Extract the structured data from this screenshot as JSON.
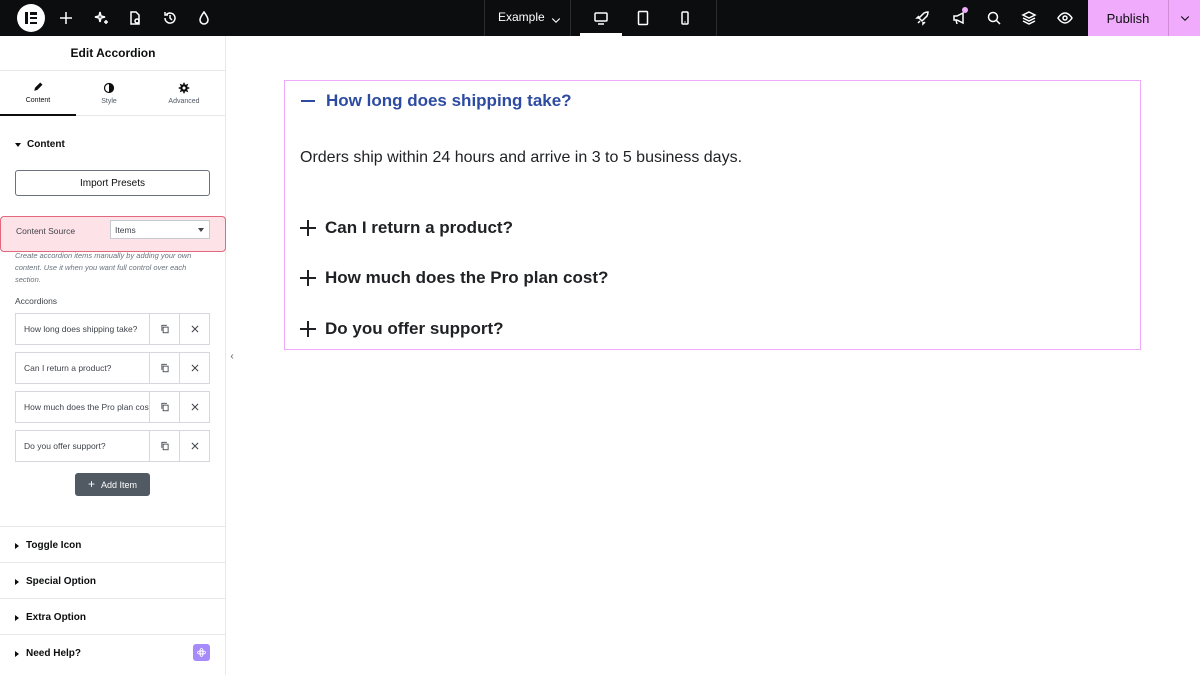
{
  "topbar": {
    "page_name": "Example",
    "publish_label": "Publish",
    "icons": [
      "elementor-logo-icon",
      "plus-icon",
      "sparkle-icon",
      "page-settings-icon",
      "history-icon",
      "theme-icon",
      "desktop-icon",
      "tablet-icon",
      "mobile-icon",
      "rocket-icon",
      "megaphone-icon",
      "search-icon",
      "layers-icon",
      "eye-icon",
      "chevron-down-icon"
    ],
    "accent_color": "#f0abfc"
  },
  "panel": {
    "title": "Edit Accordion",
    "tabs": [
      {
        "label": "Content",
        "icon": "pencil-icon",
        "active": true
      },
      {
        "label": "Style",
        "icon": "half-circle-icon",
        "active": false
      },
      {
        "label": "Advanced",
        "icon": "gear-icon",
        "active": false
      }
    ],
    "content_section": "Content",
    "import_presets": "Import Presets",
    "content_source_label": "Content Source",
    "content_source_value": "Items",
    "help_text": "Create accordion items manually by adding your own content. Use it when you want full control over each section.",
    "accordions_label": "Accordions",
    "items": [
      {
        "title": "How long does shipping take?"
      },
      {
        "title": "Can I return a product?"
      },
      {
        "title": "How much does the Pro plan cost?"
      },
      {
        "title": "Do you offer support?"
      }
    ],
    "add_item": "Add Item",
    "sections": [
      "Toggle Icon",
      "Special Option",
      "Extra Option",
      "Need Help?"
    ]
  },
  "canvas": {
    "accordion": [
      {
        "question": "How long does shipping take?",
        "open": true,
        "answer": "Orders ship within 24 hours and arrive in 3 to 5 business days."
      },
      {
        "question": "Can I return a product?",
        "open": false
      },
      {
        "question": "How much does the Pro plan cost?",
        "open": false
      },
      {
        "question": "Do you offer support?",
        "open": false
      }
    ],
    "active_color": "#2d4ba1"
  }
}
